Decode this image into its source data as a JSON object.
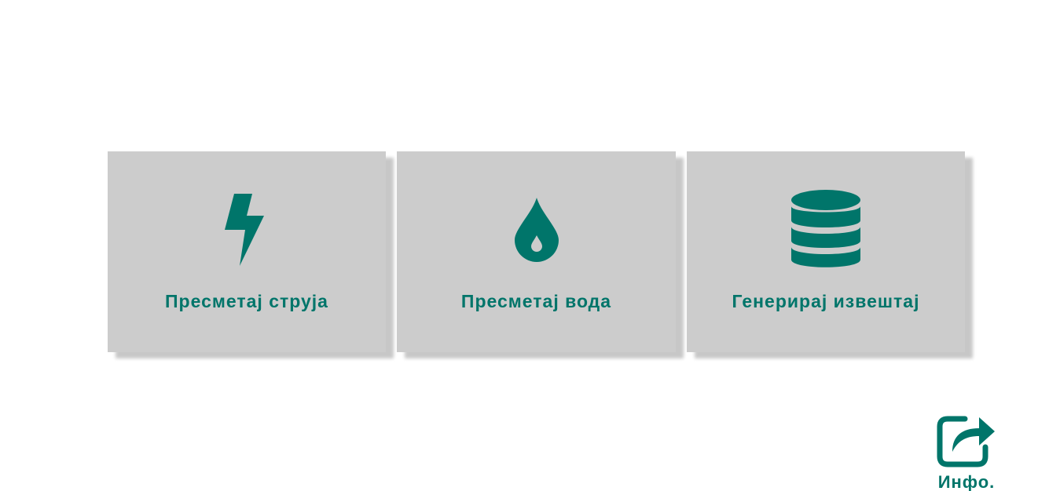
{
  "theme": {
    "accent_color": "#00756a",
    "card_background": "#cccccc",
    "page_background": "#ffffff"
  },
  "cards": [
    {
      "label": "Пресметај струја",
      "icon": "lightning-bolt-icon"
    },
    {
      "label": "Пресметај вода",
      "icon": "water-drop-icon"
    },
    {
      "label": "Генерирај извештај",
      "icon": "database-icon"
    }
  ],
  "info": {
    "label": "Инфо.",
    "icon": "share-square-icon"
  }
}
